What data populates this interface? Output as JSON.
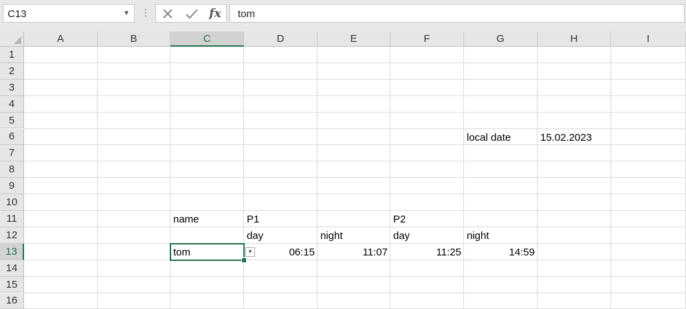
{
  "formula_bar": {
    "name_box": "C13",
    "name_box_dropdown_icon": "chevron-down-icon",
    "more_icon": "vertical-dots-icon",
    "cancel_icon": "close-icon",
    "enter_icon": "checkmark-icon",
    "function_label": "fx",
    "formula_value": "tom"
  },
  "columns": [
    "A",
    "B",
    "C",
    "D",
    "E",
    "F",
    "G",
    "H",
    "I"
  ],
  "rows": [
    "1",
    "2",
    "3",
    "4",
    "5",
    "6",
    "7",
    "8",
    "9",
    "10",
    "11",
    "12",
    "13",
    "14",
    "15",
    "16"
  ],
  "active_cell": {
    "column": "C",
    "row": "13"
  },
  "cells": {
    "G6": "local date",
    "H6": "15.02.2023",
    "C11": "name",
    "D11": "P1",
    "F11": "P2",
    "D12": "day",
    "E12": "night",
    "F12": "day",
    "G12": "night",
    "C13": "tom",
    "D13": "06:15",
    "E13": "11:07",
    "F13": "11:25",
    "G13": "14:59"
  },
  "colors": {
    "accent": "#217346",
    "header_bg": "#e6e6e6",
    "gridline": "#dadada"
  },
  "validation_dropdown_icon": "dropdown-arrow-icon"
}
